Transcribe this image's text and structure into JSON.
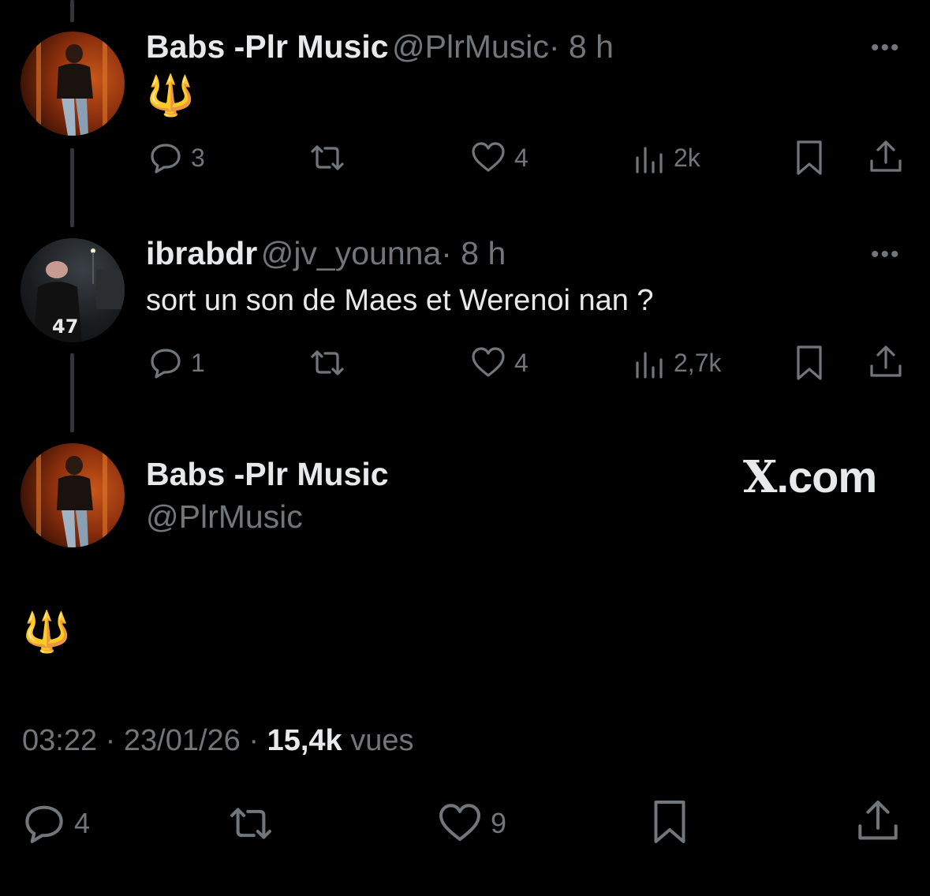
{
  "tweets": [
    {
      "name": "Babs -Plr Music",
      "handle": "@PlrMusic",
      "time": "· 8 h",
      "text": "🔱",
      "replies": "3",
      "likes": "4",
      "views": "2k"
    },
    {
      "name": "ibrabdr",
      "handle": "@jv_younna",
      "time": "· 8 h",
      "text": "sort un son de Maes et Werenoi nan ?",
      "replies": "1",
      "likes": "4",
      "views": "2,7k"
    }
  ],
  "main": {
    "name": "Babs -Plr Music",
    "handle": "@PlrMusic",
    "text": "🔱",
    "time": "03:22",
    "date": "23/01/26",
    "views_count": "15,4k",
    "views_label": "vues",
    "replies": "4",
    "likes": "9"
  },
  "watermark": {
    "mark": "X",
    "suffix": ".com"
  },
  "more_label": "•••",
  "colors": {
    "background": "#000000",
    "text": "#e7e9ea",
    "muted": "#71767b",
    "thread_line": "#333639"
  },
  "icons": [
    "reply-icon",
    "retweet-icon",
    "like-icon",
    "views-icon",
    "bookmark-icon",
    "share-icon",
    "more-icon"
  ]
}
